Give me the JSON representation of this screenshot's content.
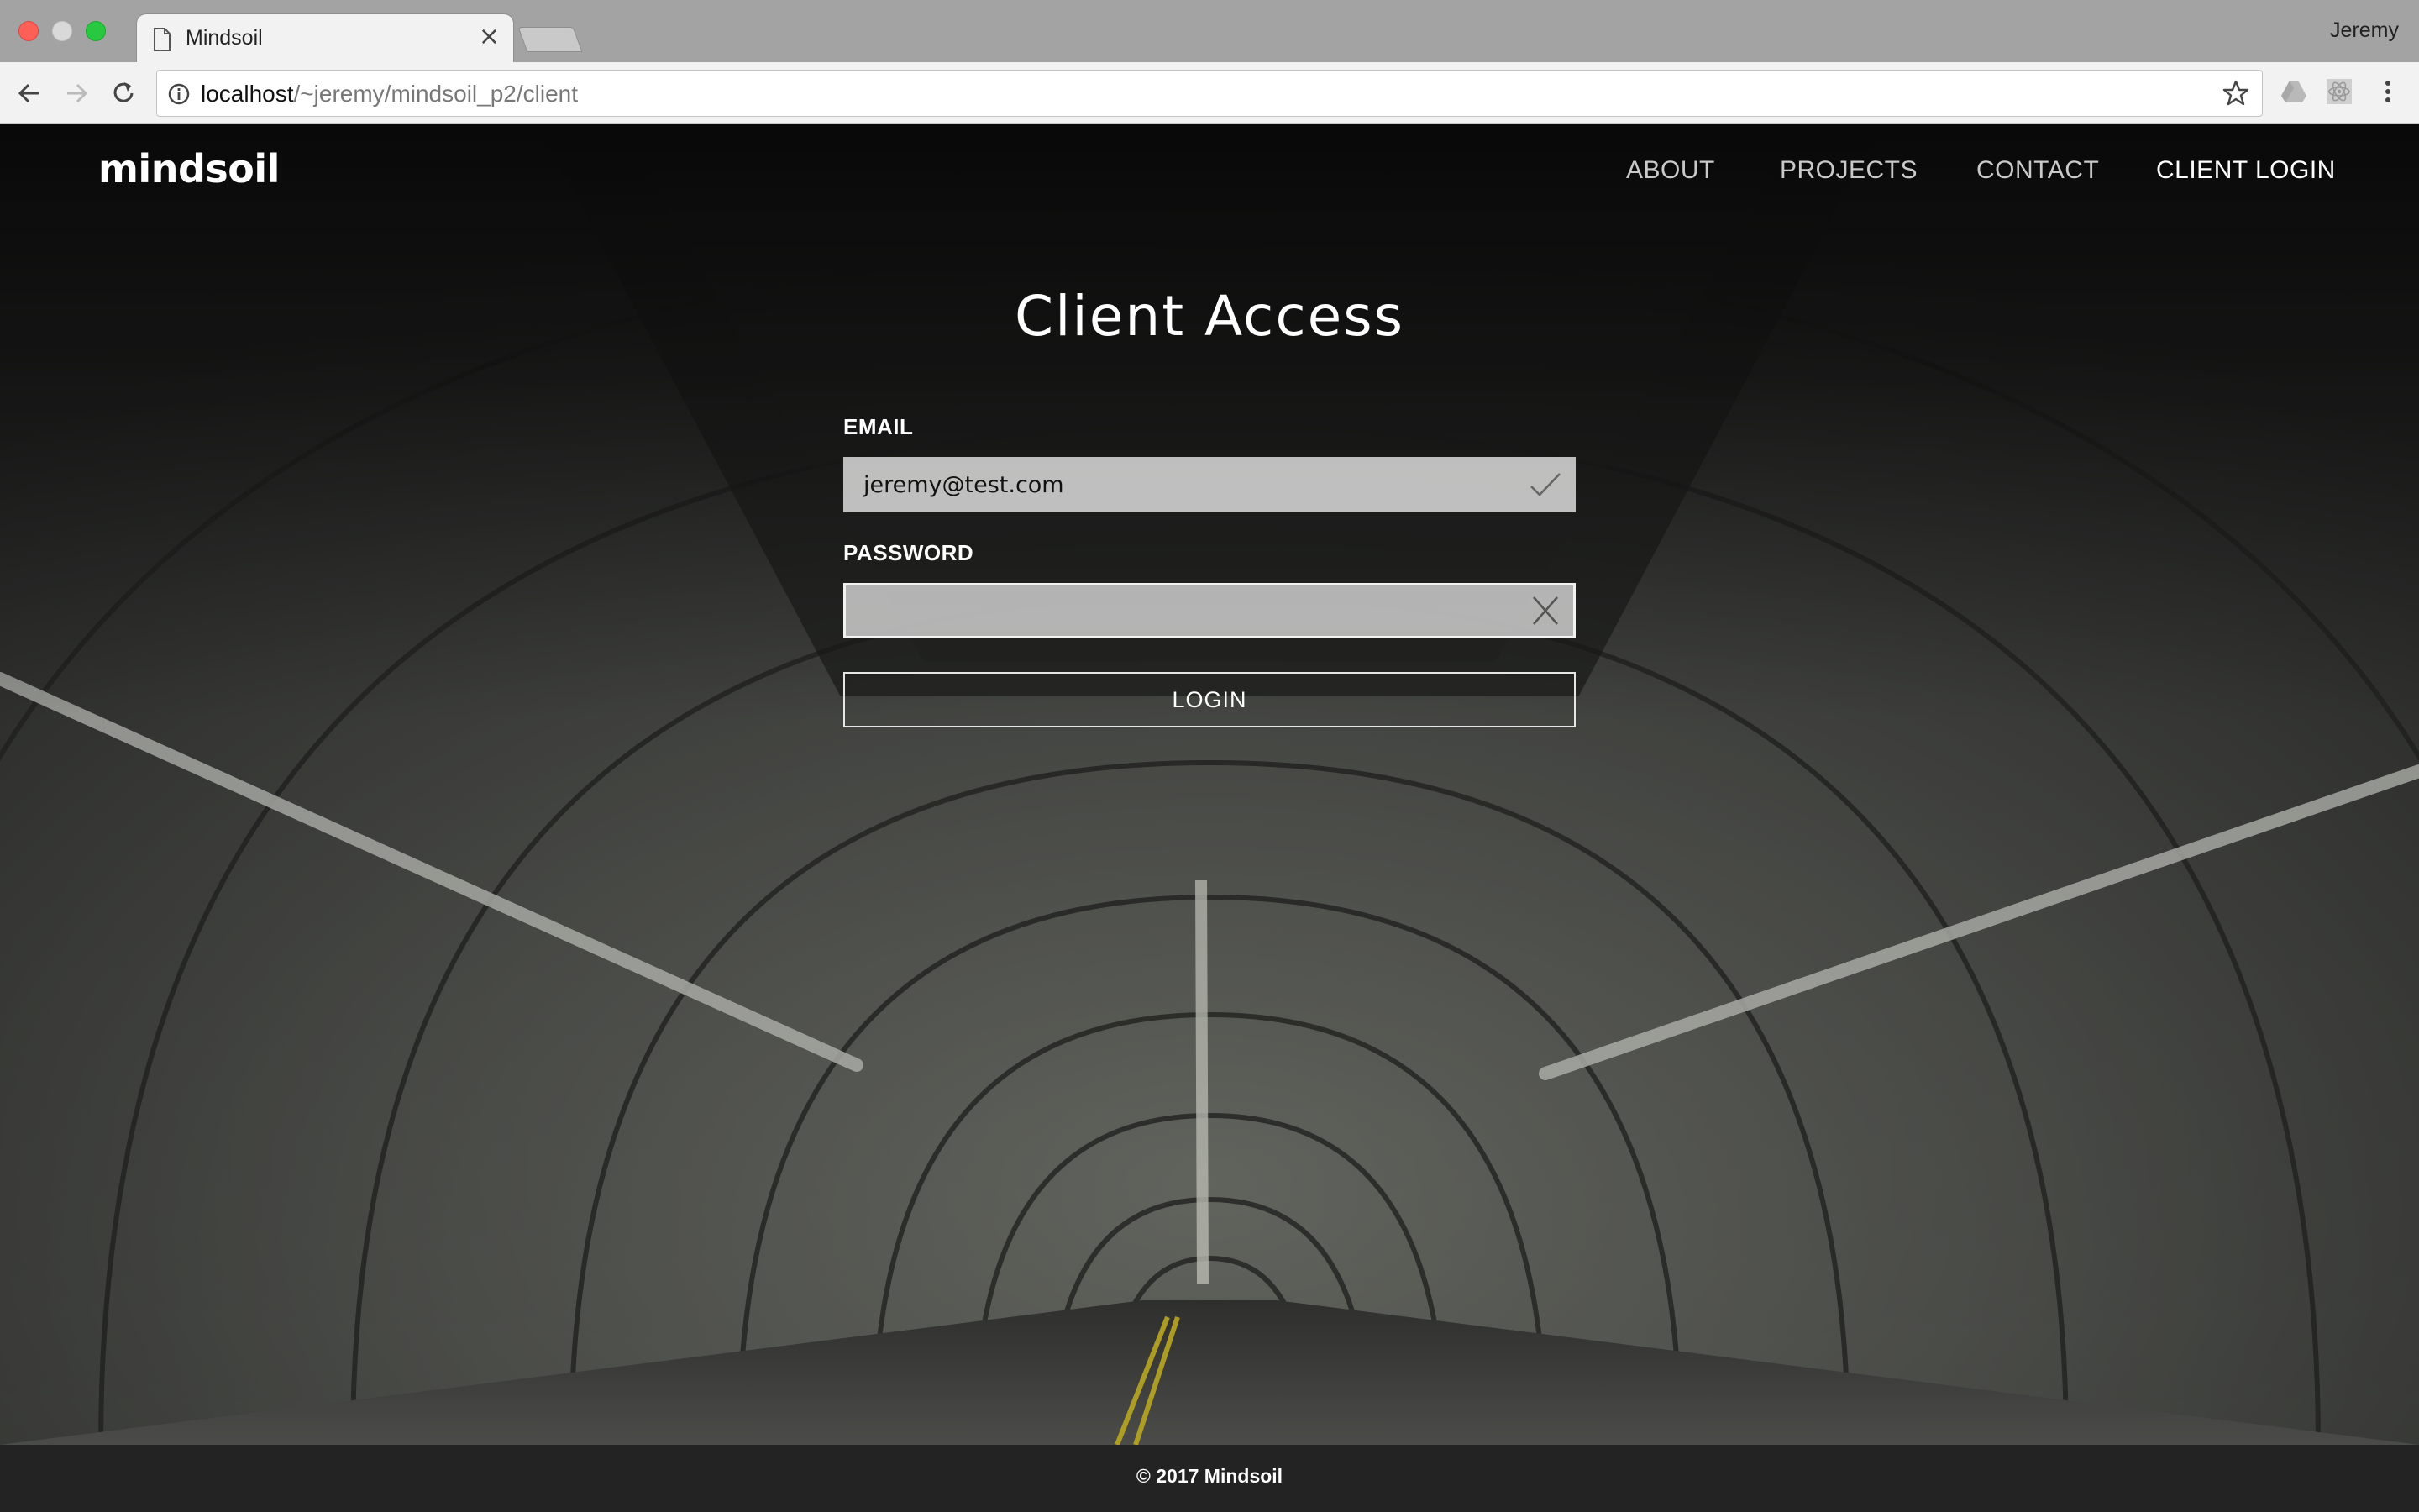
{
  "browser": {
    "tab_title": "Mindsoil",
    "tab_close": "×",
    "profile_name": "Jeremy",
    "url_host": "localhost",
    "url_path": "/~jeremy/mindsoil_p2/client"
  },
  "site": {
    "logo": "mindsoil",
    "nav": {
      "about": "ABOUT",
      "projects": "PROJECTS",
      "contact": "CONTACT",
      "client_login": "CLIENT LOGIN"
    }
  },
  "login_form": {
    "title": "Client Access",
    "email_label": "EMAIL",
    "email_value": "jeremy@test.com",
    "email_status": "valid",
    "password_label": "PASSWORD",
    "password_value": "",
    "password_status": "invalid",
    "submit_label": "LOGIN"
  },
  "footer": {
    "copyright": "© 2017 Mindsoil"
  },
  "colors": {
    "nav_active": "#ffffff",
    "nav_inactive": "#c9c9c9",
    "footer_bg": "#232323",
    "field_bg": "#cdcdcd"
  }
}
